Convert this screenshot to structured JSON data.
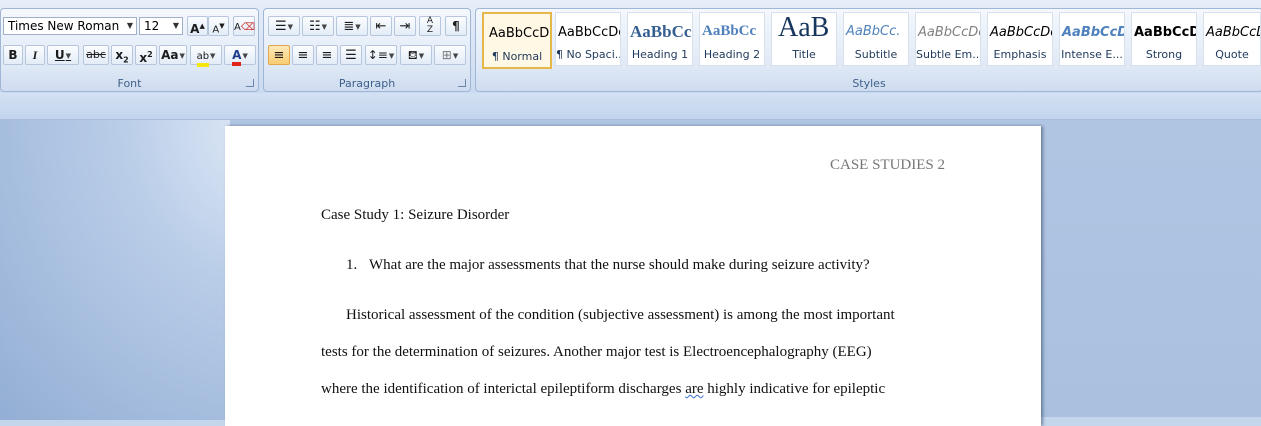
{
  "font_group": {
    "label": "Font",
    "font_name": "Times New Roman",
    "font_size": "12",
    "grow_label": "A",
    "shrink_label": "A",
    "clear_label": "A",
    "bold": "B",
    "italic": "I",
    "underline": "U",
    "strike": "abc",
    "subscript": "x",
    "superscript": "x",
    "change_case": "Aa",
    "highlight": "ab",
    "font_color": "A"
  },
  "paragraph_group": {
    "label": "Paragraph"
  },
  "styles_group": {
    "label": "Styles",
    "items": [
      {
        "sample": "AaBbCcDc",
        "name": "¶ Normal"
      },
      {
        "sample": "AaBbCcDc",
        "name": "¶ No Spaci..."
      },
      {
        "sample": "AaBbCc",
        "name": "Heading 1"
      },
      {
        "sample": "AaBbCc",
        "name": "Heading 2"
      },
      {
        "sample": "AaB",
        "name": "Title"
      },
      {
        "sample": "AaBbCc.",
        "name": "Subtitle"
      },
      {
        "sample": "AaBbCcDc",
        "name": "Subtle Em..."
      },
      {
        "sample": "AaBbCcDc",
        "name": "Emphasis"
      },
      {
        "sample": "AaBbCcDc",
        "name": "Intense E..."
      },
      {
        "sample": "AaBbCcDc",
        "name": "Strong"
      },
      {
        "sample": "AaBbCcDc",
        "name": "Quote"
      }
    ]
  },
  "document": {
    "header": "CASE STUDIES 2",
    "heading": "Case Study 1: Seizure Disorder",
    "question_number": "1.",
    "question": "What are the major assessments that the nurse should make during seizure activity?",
    "para_line1": "Historical assessment of the condition (subjective assessment) is among the most important",
    "para_line2": "tests for the determination of seizures. Another major test is Electroencephalography (EEG)",
    "para_line3_a": "where the identification of interictal epileptiform discharges ",
    "para_line3_b": "are",
    "para_line3_c": " highly indicative for epileptic"
  },
  "colors": {
    "accent_highlight": "#f5e60f",
    "font_color_bar": "#e0241c",
    "selected_style_border": "#e7b649"
  }
}
